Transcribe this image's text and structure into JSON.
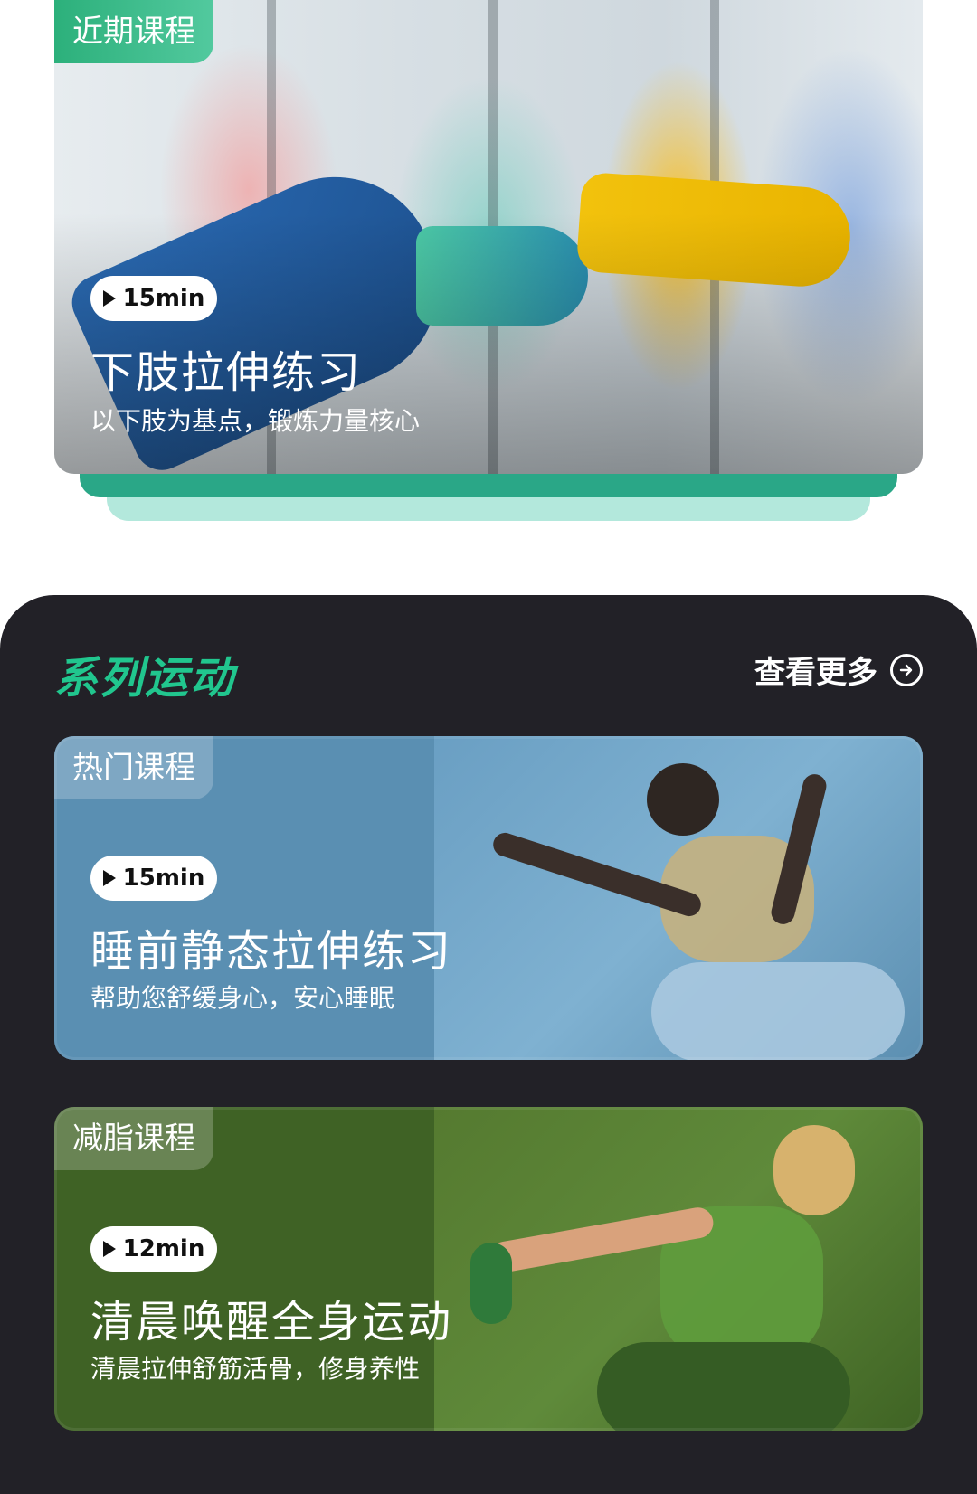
{
  "recent": {
    "tag": "近期课程",
    "duration": "15min",
    "title": "下肢拉伸练习",
    "subtitle": "以下肢为基点，锻炼力量核心"
  },
  "series": {
    "title": "系列运动",
    "more_label": "查看更多",
    "cards": [
      {
        "tag": "热门课程",
        "duration": "15min",
        "title": "睡前静态拉伸练习",
        "subtitle": "帮助您舒缓身心，安心睡眠",
        "color": "#5a8fb2"
      },
      {
        "tag": "减脂课程",
        "duration": "12min",
        "title": "清晨唤醒全身运动",
        "subtitle": "清晨拉伸舒筋活骨，修身养性",
        "color": "#3f6225"
      }
    ]
  },
  "colors": {
    "accent": "#21c68e",
    "dark_bg": "#222127",
    "stack_mid": "#2aa787",
    "stack_back": "#b3e8dc"
  }
}
